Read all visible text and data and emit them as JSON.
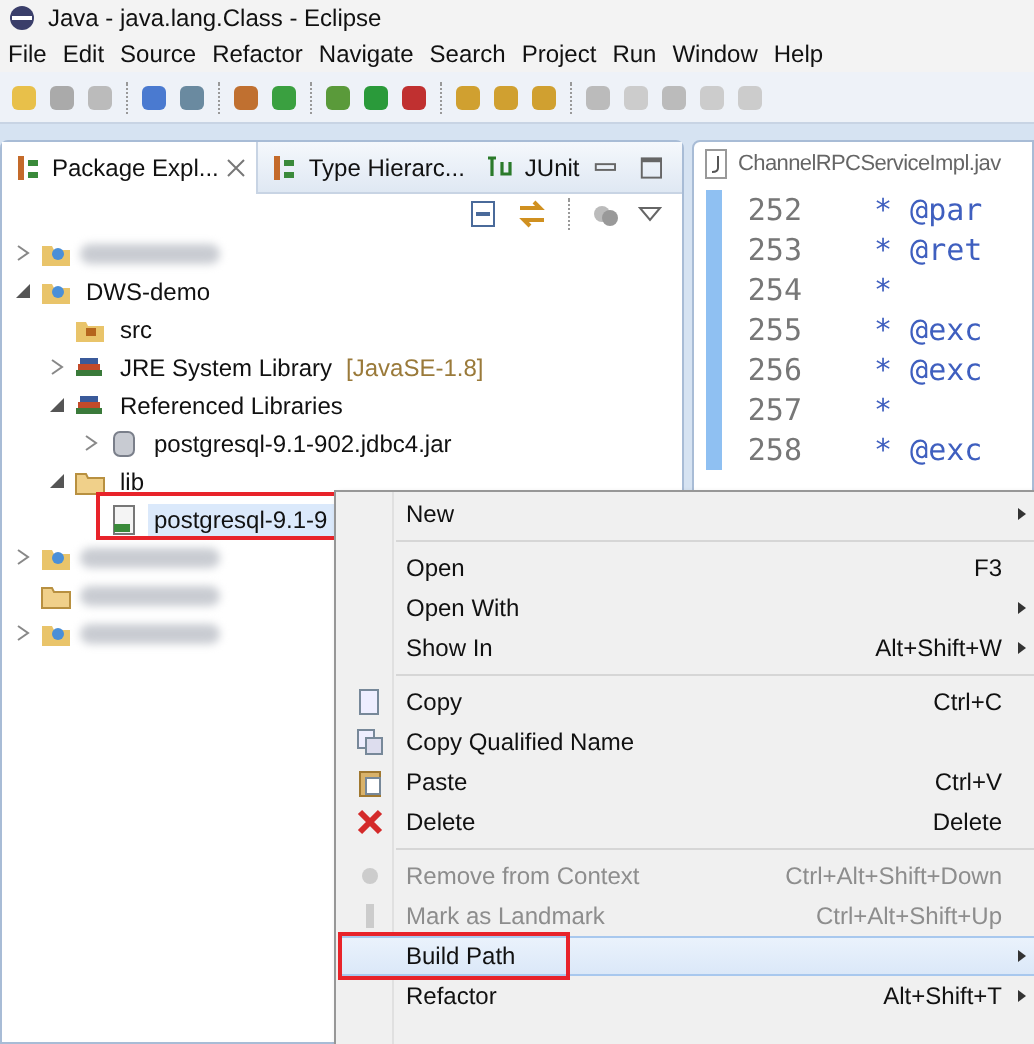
{
  "window": {
    "title": "Java - java.lang.Class - Eclipse"
  },
  "menu_bar": [
    "File",
    "Edit",
    "Source",
    "Refactor",
    "Navigate",
    "Search",
    "Project",
    "Run",
    "Window",
    "Help"
  ],
  "left_panel": {
    "tabs": [
      {
        "label": "Package Expl...",
        "selected": true
      },
      {
        "label": "Type Hierarc...",
        "selected": false
      },
      {
        "label": "JUnit",
        "selected": false
      }
    ],
    "tree": [
      {
        "kind": "blurred-project",
        "expanded": false,
        "selected": false,
        "highlighted": false
      },
      {
        "kind": "project",
        "label": "DWS-demo",
        "expanded": true,
        "selected": false,
        "highlighted": false,
        "children": [
          {
            "kind": "source-folder",
            "label": "src",
            "selected": false,
            "highlighted": false
          },
          {
            "kind": "library",
            "label": "JRE System Library",
            "decoration": "[JavaSE-1.8]",
            "expanded": false,
            "selected": false,
            "highlighted": false
          },
          {
            "kind": "library",
            "label": "Referenced Libraries",
            "expanded": true,
            "selected": false,
            "highlighted": false,
            "children": [
              {
                "kind": "jar",
                "label": "postgresql-9.1-902.jdbc4.jar",
                "expanded": false,
                "selected": false,
                "highlighted": false
              }
            ]
          },
          {
            "kind": "folder",
            "label": "lib",
            "expanded": true,
            "selected": false,
            "highlighted": false,
            "children": [
              {
                "kind": "file",
                "label": "postgresql-9.1-9",
                "selected": true,
                "highlighted": true
              }
            ]
          }
        ]
      },
      {
        "kind": "blurred-project",
        "expanded": false,
        "selected": false,
        "highlighted": false
      },
      {
        "kind": "blurred-folder",
        "selected": false,
        "highlighted": false
      },
      {
        "kind": "blurred-project",
        "expanded": false,
        "selected": false,
        "highlighted": false
      }
    ]
  },
  "editor": {
    "tab": "ChannelRPCServiceImpl.jav",
    "lines": [
      {
        "number": "252",
        "code": "* @par"
      },
      {
        "number": "253",
        "code": "* @ret"
      },
      {
        "number": "254",
        "code": "*"
      },
      {
        "number": "255",
        "code": "* @exc"
      },
      {
        "number": "256",
        "code": "* @exc"
      },
      {
        "number": "257",
        "code": "*"
      },
      {
        "number": "258",
        "code": "* @exc"
      }
    ]
  },
  "context_menu": {
    "groups": [
      [
        {
          "kind": "plain",
          "label": "New",
          "submenu": true,
          "disabled": false,
          "selected": false,
          "highlighted": false
        }
      ],
      [
        {
          "kind": "plain",
          "label": "Open",
          "shortcut": "F3",
          "submenu": false,
          "disabled": false,
          "selected": false,
          "highlighted": false
        },
        {
          "kind": "plain",
          "label": "Open With",
          "submenu": true,
          "disabled": false,
          "selected": false,
          "highlighted": false
        },
        {
          "kind": "plain",
          "label": "Show In",
          "shortcut": "Alt+Shift+W",
          "submenu": true,
          "disabled": false,
          "selected": false,
          "highlighted": false
        }
      ],
      [
        {
          "kind": "copy",
          "label": "Copy",
          "shortcut": "Ctrl+C",
          "submenu": false,
          "disabled": false,
          "selected": false,
          "highlighted": false
        },
        {
          "kind": "copy-name",
          "label": "Copy Qualified Name",
          "submenu": false,
          "disabled": false,
          "selected": false,
          "highlighted": false
        },
        {
          "kind": "paste",
          "label": "Paste",
          "shortcut": "Ctrl+V",
          "submenu": false,
          "disabled": false,
          "selected": false,
          "highlighted": false
        },
        {
          "kind": "delete",
          "label": "Delete",
          "shortcut": "Delete",
          "submenu": false,
          "disabled": false,
          "selected": false,
          "highlighted": false
        }
      ],
      [
        {
          "kind": "remove",
          "label": "Remove from Context",
          "shortcut": "Ctrl+Alt+Shift+Down",
          "submenu": false,
          "disabled": true,
          "selected": false,
          "highlighted": false
        },
        {
          "kind": "landmark",
          "label": "Mark as Landmark",
          "shortcut": "Ctrl+Alt+Shift+Up",
          "submenu": false,
          "disabled": true,
          "selected": false,
          "highlighted": false
        },
        {
          "kind": "plain",
          "label": "Build Path",
          "submenu": true,
          "disabled": false,
          "selected": true,
          "highlighted": true
        },
        {
          "kind": "plain",
          "label": "Refactor",
          "shortcut": "Alt+Shift+T",
          "submenu": true,
          "disabled": false,
          "selected": false,
          "highlighted": false
        }
      ]
    ]
  }
}
